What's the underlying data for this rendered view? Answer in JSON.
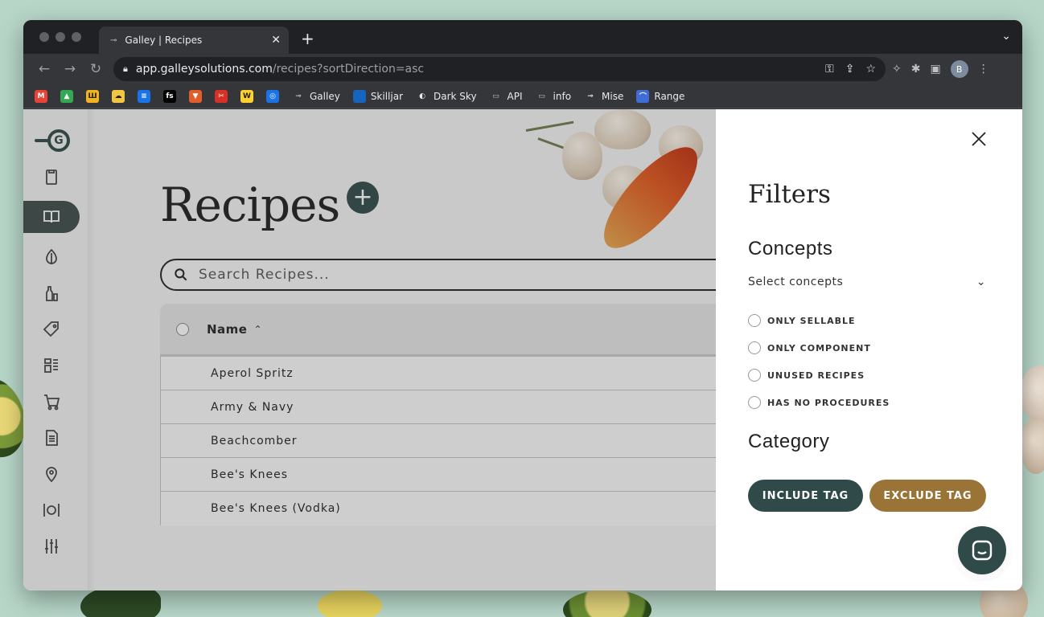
{
  "browser": {
    "tab_title": "Galley | Recipes",
    "tab_favicon": "galley-logo-icon",
    "url_host": "app.galleysolutions.com",
    "url_path": "/recipes?sortDirection=asc",
    "profile_initial": "B",
    "bookmarks": [
      {
        "icon": "gmail-icon",
        "label": ""
      },
      {
        "icon": "google-drive-icon",
        "label": ""
      },
      {
        "icon": "app-icon-yellow",
        "label": ""
      },
      {
        "icon": "cloud-icon",
        "label": ""
      },
      {
        "icon": "app-icon-blue",
        "label": ""
      },
      {
        "icon": "fs-icon",
        "label": ""
      },
      {
        "icon": "app-icon-triangle",
        "label": ""
      },
      {
        "icon": "app-icon-red",
        "label": ""
      },
      {
        "icon": "miro-icon",
        "label": ""
      },
      {
        "icon": "fingerprint-icon",
        "label": ""
      },
      {
        "icon": "galley-icon",
        "label": "Galley"
      },
      {
        "icon": "skilljar-icon",
        "label": "Skilljar"
      },
      {
        "icon": "darksky-icon",
        "label": "Dark Sky"
      },
      {
        "icon": "folder-icon",
        "label": "API"
      },
      {
        "icon": "folder-icon",
        "label": "info"
      },
      {
        "icon": "mise-icon",
        "label": "Mise"
      },
      {
        "icon": "range-icon",
        "label": "Range"
      }
    ]
  },
  "page": {
    "title": "Recipes",
    "search_placeholder": "Search Recipes...",
    "table_header": "Name",
    "rows": [
      "Aperol Spritz",
      "Army & Navy",
      "Beachcomber",
      "Bee's Knees",
      "Bee's Knees (Vodka)"
    ]
  },
  "filters": {
    "title": "Filters",
    "concepts_heading": "Concepts",
    "concepts_select": "Select concepts",
    "options": [
      "ONLY SELLABLE",
      "ONLY COMPONENT",
      "UNUSED RECIPES",
      "HAS NO PROCEDURES"
    ],
    "category_heading": "Category",
    "include_tag": "INCLUDE TAG",
    "exclude_tag": "EXCLUDE TAG"
  },
  "colors": {
    "brand_dark": "#2f4a48",
    "brand_gold": "#9a7436"
  }
}
